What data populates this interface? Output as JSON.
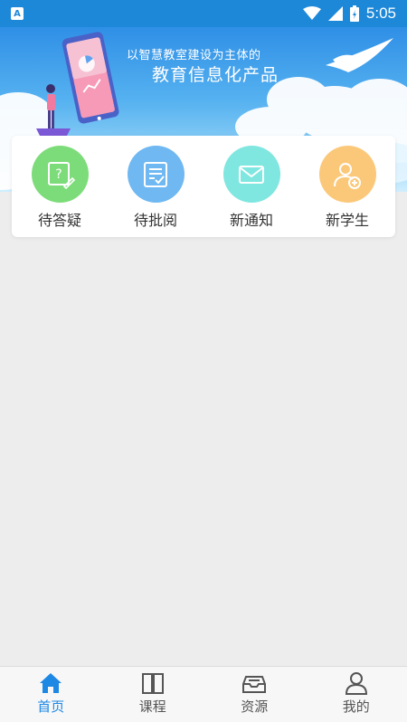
{
  "status_bar": {
    "app_badge": "A",
    "time": "5:05",
    "icons": [
      "wifi-icon",
      "signal-icon",
      "battery-icon"
    ]
  },
  "banner": {
    "line1": "以智慧教室建设为主体的",
    "line2": "教育信息化产品"
  },
  "quick_actions": [
    {
      "label": "待答疑",
      "icon": "question-edit-icon",
      "color": "#7ddc7a"
    },
    {
      "label": "待批阅",
      "icon": "review-list-icon",
      "color": "#6fb8f2"
    },
    {
      "label": "新通知",
      "icon": "envelope-icon",
      "color": "#7fe6e0"
    },
    {
      "label": "新学生",
      "icon": "add-user-icon",
      "color": "#fbc87a"
    }
  ],
  "tabs": [
    {
      "label": "首页",
      "icon": "home-icon",
      "active": true
    },
    {
      "label": "课程",
      "icon": "book-icon",
      "active": false
    },
    {
      "label": "资源",
      "icon": "inbox-icon",
      "active": false
    },
    {
      "label": "我的",
      "icon": "person-icon",
      "active": false
    }
  ],
  "colors": {
    "accent": "#1e88e5",
    "status_bar": "#1e88d8"
  }
}
